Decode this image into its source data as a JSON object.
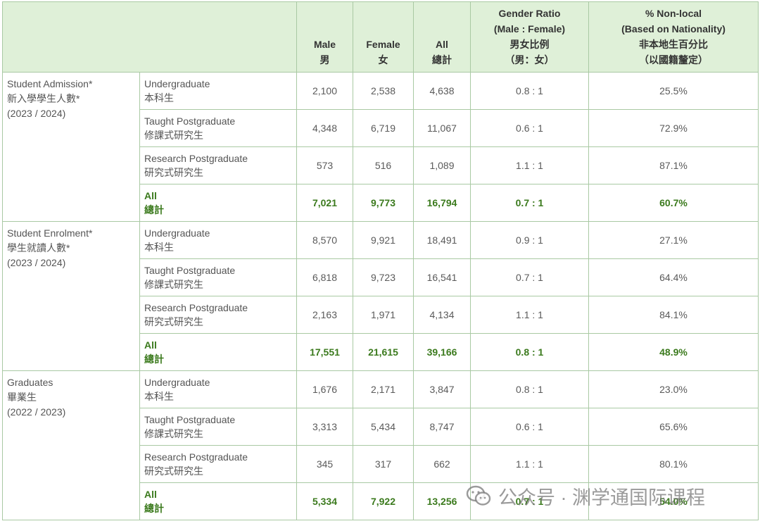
{
  "headers": {
    "male": [
      "Male",
      "男"
    ],
    "female": [
      "Female",
      "女"
    ],
    "all": [
      "All",
      "總計"
    ],
    "gender_ratio": [
      "Gender Ratio",
      "(Male : Female)",
      "男女比例",
      "（男：女）"
    ],
    "non_local": [
      "% Non-local",
      "(Based on Nationality)",
      "非本地生百分比",
      "（以國籍釐定）"
    ]
  },
  "groups": [
    {
      "title": [
        "Student Admission*",
        "新入學學生人數*",
        "(2023 / 2024)"
      ],
      "rows": [
        {
          "level": [
            "Undergraduate",
            "本科生"
          ],
          "male": "2,100",
          "female": "2,538",
          "all": "4,638",
          "ratio": "0.8 : 1",
          "nonlocal": "25.5%"
        },
        {
          "level": [
            "Taught Postgraduate",
            "修課式研究生"
          ],
          "male": "4,348",
          "female": "6,719",
          "all": "11,067",
          "ratio": "0.6 : 1",
          "nonlocal": "72.9%"
        },
        {
          "level": [
            "Research Postgraduate",
            "研究式研究生"
          ],
          "male": "573",
          "female": "516",
          "all": "1,089",
          "ratio": "1.1 : 1",
          "nonlocal": "87.1%"
        },
        {
          "level": [
            "All",
            "總計"
          ],
          "male": "7,021",
          "female": "9,773",
          "all": "16,794",
          "ratio": "0.7 : 1",
          "nonlocal": "60.7%",
          "total": true
        }
      ]
    },
    {
      "title": [
        "Student Enrolment*",
        "學生就讀人數*",
        "(2023 / 2024)"
      ],
      "rows": [
        {
          "level": [
            "Undergraduate",
            "本科生"
          ],
          "male": "8,570",
          "female": "9,921",
          "all": "18,491",
          "ratio": "0.9 : 1",
          "nonlocal": "27.1%"
        },
        {
          "level": [
            "Taught Postgraduate",
            "修課式研究生"
          ],
          "male": "6,818",
          "female": "9,723",
          "all": "16,541",
          "ratio": "0.7 : 1",
          "nonlocal": "64.4%"
        },
        {
          "level": [
            "Research Postgraduate",
            "研究式研究生"
          ],
          "male": "2,163",
          "female": "1,971",
          "all": "4,134",
          "ratio": "1.1 : 1",
          "nonlocal": "84.1%"
        },
        {
          "level": [
            "All",
            "總計"
          ],
          "male": "17,551",
          "female": "21,615",
          "all": "39,166",
          "ratio": "0.8 : 1",
          "nonlocal": "48.9%",
          "total": true
        }
      ]
    },
    {
      "title": [
        "Graduates",
        "畢業生",
        "(2022 / 2023)"
      ],
      "rows": [
        {
          "level": [
            "Undergraduate",
            "本科生"
          ],
          "male": "1,676",
          "female": "2,171",
          "all": "3,847",
          "ratio": "0.8 : 1",
          "nonlocal": "23.0%"
        },
        {
          "level": [
            "Taught Postgraduate",
            "修課式研究生"
          ],
          "male": "3,313",
          "female": "5,434",
          "all": "8,747",
          "ratio": "0.6 : 1",
          "nonlocal": "65.6%"
        },
        {
          "level": [
            "Research Postgraduate",
            "研究式研究生"
          ],
          "male": "345",
          "female": "317",
          "all": "662",
          "ratio": "1.1 : 1",
          "nonlocal": "80.1%"
        },
        {
          "level": [
            "All",
            "總計"
          ],
          "male": "5,334",
          "female": "7,922",
          "all": "13,256",
          "ratio": "0.7 : 1",
          "nonlocal": "54.0%",
          "total": true
        }
      ]
    }
  ],
  "watermark": {
    "text": "公众号 · 渊学通国际课程",
    "icon": "wechat-icon"
  }
}
